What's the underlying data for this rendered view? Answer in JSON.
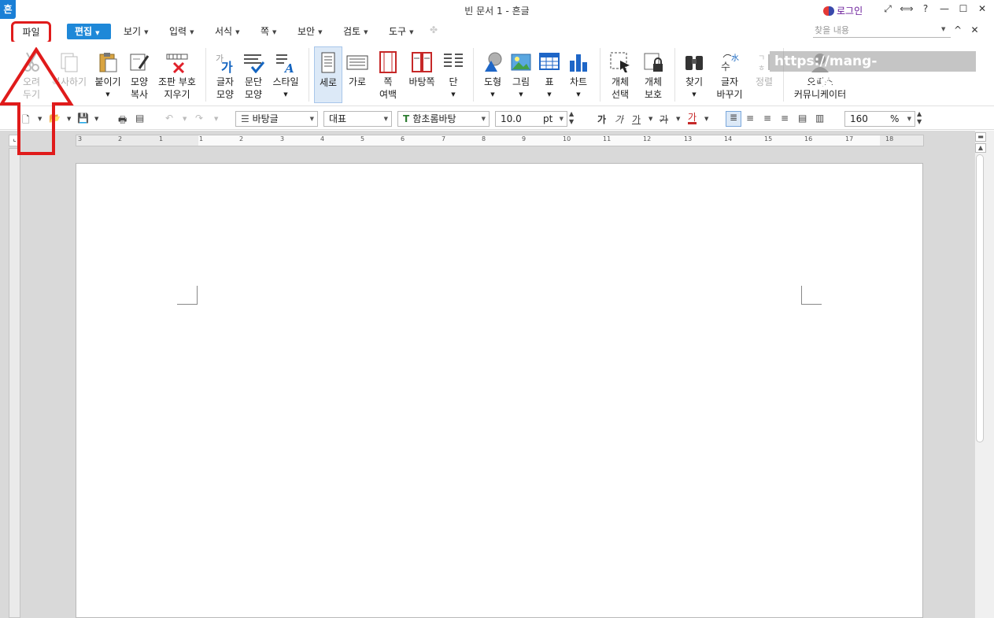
{
  "titlebar": {
    "app_logo": "흔",
    "title": "빈 문서 1 - 흔글",
    "login": "로그인",
    "icons": [
      "expand-icon",
      "fit-icon",
      "help-icon",
      "minimize-icon",
      "maximize-icon",
      "close-icon"
    ],
    "help": "?"
  },
  "menubar": {
    "file": "파일",
    "edit": "편집",
    "items": [
      "보기",
      "입력",
      "서식",
      "쪽",
      "보안",
      "검토",
      "도구"
    ],
    "search_placeholder": "찾을 내용"
  },
  "ribbon": {
    "cut": "오려\n두기",
    "copy": "복사하기",
    "paste": "붙이기",
    "shape_copy": "모양\n복사",
    "clear_marks": "조판 부호\n지우기",
    "char_shape": "글자\n모양",
    "para_shape": "문단\n모양",
    "style": "스타일",
    "vertical": "세로",
    "horizontal": "가로",
    "page_margin": "쪽\n여백",
    "page_bg": "바탕쪽",
    "column": "단",
    "shape": "도형",
    "picture": "그림",
    "table": "표",
    "chart": "차트",
    "obj_select": "개체\n선택",
    "obj_protect": "개체\n보호",
    "find": "찾기",
    "replace": "글자\n바꾸기",
    "sort": "정렬",
    "office": "오피스\n커뮤니케이터"
  },
  "watermark": "https://mang-note.tistory.com",
  "fmtbar": {
    "style": "바탕글",
    "lang": "대표",
    "font": "함초롬바탕",
    "size": "10.0",
    "unit": "pt",
    "zoom": "160",
    "zoom_unit": "%",
    "bold": "가",
    "italic": "가",
    "underline": "가",
    "strike": "가",
    "color": "가"
  },
  "ruler": {
    "h_numbers": [
      "3",
      "2",
      "1",
      "1",
      "2",
      "3",
      "4",
      "5",
      "6",
      "7",
      "8",
      "9",
      "10",
      "11",
      "12",
      "13",
      "14",
      "15",
      "16",
      "17",
      "18"
    ]
  },
  "colors": {
    "accent": "#1e88d8",
    "annotation": "#e01b1b"
  }
}
